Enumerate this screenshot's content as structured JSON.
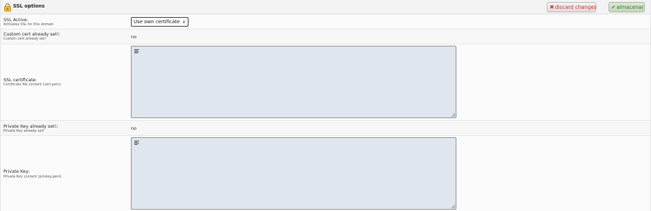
{
  "header": {
    "title": "SSL options",
    "discard_label": "discard changes",
    "save_label": "almacenar"
  },
  "ssl_active": {
    "label": "SSL Active:",
    "description": "Activates SSL for this domain",
    "selected": "Use own certificate"
  },
  "custom_cert_set": {
    "label": "Custom cert already set!:",
    "description": "Custom cert already set!",
    "value": "no"
  },
  "ssl_certificate": {
    "label": "SSL certificate:",
    "description": "Certificate file content (cert.pem)",
    "value": ""
  },
  "private_key_set": {
    "label": "Private Key already set!:",
    "description": "Private Key already set!",
    "value": "no"
  },
  "private_key": {
    "label": "Private Key:",
    "description": "Private Key content (privkey.pem)",
    "value": ""
  },
  "colors": {
    "header_bg": "#f3f3f3",
    "discard_text": "#d0313a",
    "save_text": "#2f7d34",
    "textarea_bg": "#e0e6ee"
  }
}
